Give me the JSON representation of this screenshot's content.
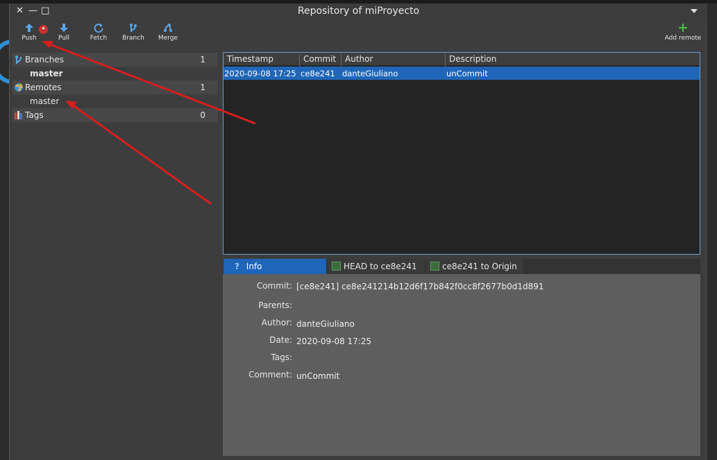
{
  "window": {
    "title": "Repository of miProyecto",
    "close": "✕",
    "minimize": "—",
    "maximize": "□"
  },
  "toolbar": {
    "push": "Push",
    "push_badge": "*",
    "pull": "Pull",
    "fetch": "Fetch",
    "branch": "Branch",
    "merge": "Merge",
    "add_remote": "Add remote"
  },
  "tree": {
    "branches": {
      "label": "Branches",
      "count": "1",
      "child": "master"
    },
    "remotes": {
      "label": "Remotes",
      "count": "1",
      "child": "master"
    },
    "tags": {
      "label": "Tags",
      "count": "0"
    }
  },
  "log": {
    "columns": [
      "Timestamp",
      "Commit",
      "Author",
      "Description"
    ],
    "rows": [
      {
        "timestamp": "2020-09-08 17:25",
        "commit": "ce8e241",
        "author": "danteGiuliano",
        "description": "unCommit"
      }
    ]
  },
  "tabs": {
    "info": "Info",
    "head": "HEAD to ce8e241",
    "origin": "ce8e241 to Origin"
  },
  "info": {
    "commit_label": "Commit:",
    "commit_value": "[ce8e241] ce8e241214b12d6f17b842f0cc8f2677b0d1d891",
    "parents_label": "Parents:",
    "parents_value": "",
    "author_label": "Author:",
    "author_value": "danteGiuliano",
    "date_label": "Date:",
    "date_value": "2020-09-08 17:25",
    "tags_label": "Tags:",
    "tags_value": "",
    "comment_label": "Comment:",
    "comment_value": "unCommit"
  },
  "colors": {
    "accent": "#1f66b8",
    "annotation_arrow": "#d81e1e",
    "icon_blue": "#5aa6e8",
    "add_green": "#4cc24c"
  }
}
